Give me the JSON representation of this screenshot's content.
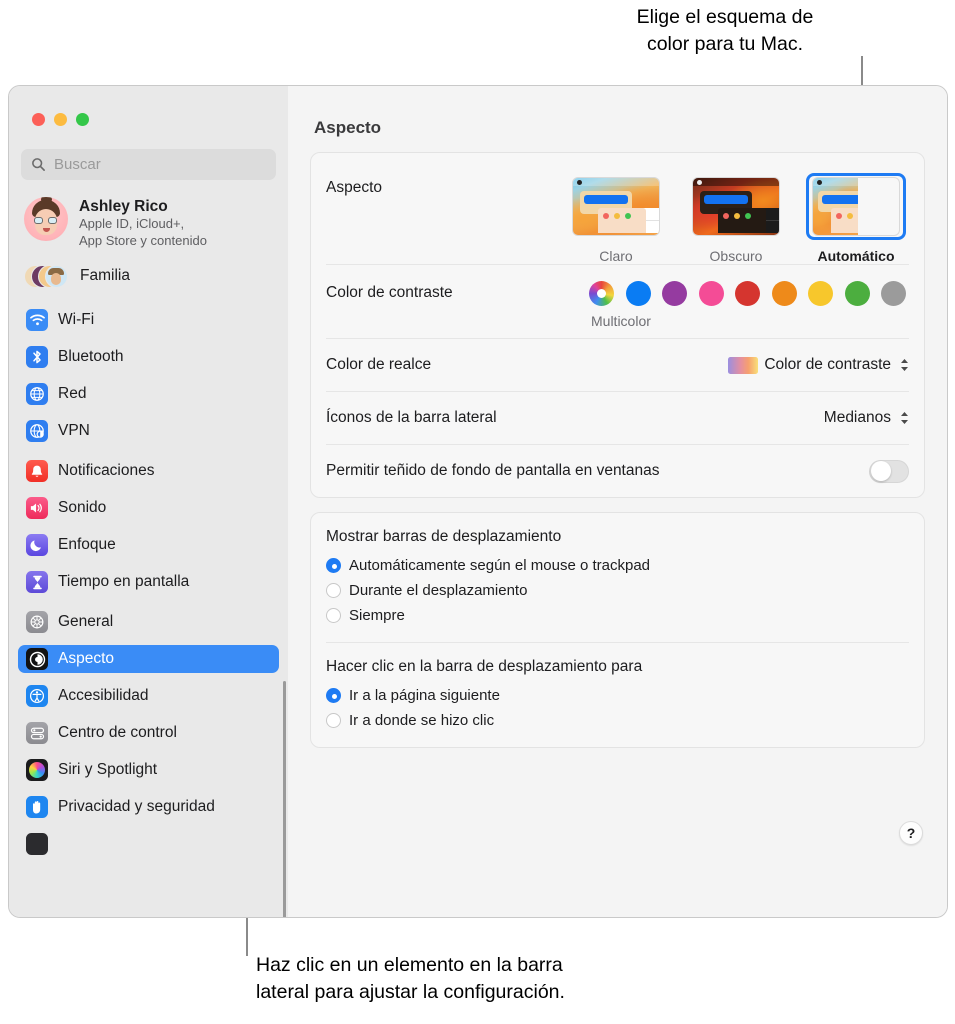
{
  "callouts": {
    "top": "Elige el esquema de\ncolor para tu Mac.",
    "bottom": "Haz clic en un elemento en la barra\nlateral para ajustar la configuración."
  },
  "window": {
    "title": "Aspecto"
  },
  "sidebar": {
    "search": {
      "placeholder": "Buscar",
      "value": ""
    },
    "account": {
      "name": "Ashley Rico",
      "subtitle_line1": "Apple ID, iCloud+,",
      "subtitle_line2": "App Store y contenido"
    },
    "family": {
      "label": "Familia"
    },
    "groups": [
      {
        "items": [
          {
            "label": "Wi-Fi",
            "icon": "wifi-icon",
            "color": "#3a8cf6",
            "selected": false
          },
          {
            "label": "Bluetooth",
            "icon": "bluetooth-icon",
            "color": "#2f7ef0",
            "selected": false
          },
          {
            "label": "Red",
            "icon": "globe-icon",
            "color": "#2f7ef0",
            "selected": false
          },
          {
            "label": "VPN",
            "icon": "vpn-globe-icon",
            "color": "#2f7ef0",
            "selected": false
          }
        ]
      },
      {
        "items": [
          {
            "label": "Notificaciones",
            "icon": "bell-icon",
            "color": "#f5453c",
            "selected": false
          },
          {
            "label": "Sonido",
            "icon": "speaker-icon",
            "color": "#f43f6e",
            "selected": false
          },
          {
            "label": "Enfoque",
            "icon": "moon-icon",
            "color": "#6d5de8",
            "selected": false
          },
          {
            "label": "Tiempo en pantalla",
            "icon": "hourglass-icon",
            "color": "#6f5fe0",
            "selected": false
          }
        ]
      },
      {
        "items": [
          {
            "label": "General",
            "icon": "gear-icon",
            "color": "#8e8e93",
            "selected": false
          },
          {
            "label": "Aspecto",
            "icon": "appearance-icon",
            "color": "#1c1c1e",
            "selected": true
          },
          {
            "label": "Accesibilidad",
            "icon": "accessibility-icon",
            "color": "#1e86f0",
            "selected": false
          },
          {
            "label": "Centro de control",
            "icon": "control-center-icon",
            "color": "#8e8e93",
            "selected": false
          },
          {
            "label": "Siri y Spotlight",
            "icon": "siri-icon",
            "color": "#2b2b2b",
            "selected": false
          },
          {
            "label": "Privacidad y seguridad",
            "icon": "hand-icon",
            "color": "#1e86f0",
            "selected": false
          }
        ]
      }
    ]
  },
  "main": {
    "appearance": {
      "label": "Aspecto",
      "options": [
        {
          "label": "Claro",
          "selected": false
        },
        {
          "label": "Obscuro",
          "selected": false
        },
        {
          "label": "Automático",
          "selected": true
        }
      ]
    },
    "accent": {
      "label": "Color de contraste",
      "caption": "Multicolor",
      "swatches": [
        {
          "name": "multicolor",
          "color": "multicolor",
          "selected": true
        },
        {
          "name": "blue",
          "color": "#0a7cf3"
        },
        {
          "name": "purple",
          "color": "#953ba0"
        },
        {
          "name": "pink",
          "color": "#f44c96"
        },
        {
          "name": "red",
          "color": "#d5352f"
        },
        {
          "name": "orange",
          "color": "#ee8a1a"
        },
        {
          "name": "yellow",
          "color": "#f7c72c"
        },
        {
          "name": "green",
          "color": "#4cae3f"
        },
        {
          "name": "graphite",
          "color": "#9b9b9b"
        }
      ]
    },
    "highlight": {
      "label": "Color de realce",
      "value": "Color de contraste"
    },
    "sidebar_icons": {
      "label": "Íconos de la barra lateral",
      "value": "Medianos"
    },
    "wallpaper_tint": {
      "label": "Permitir teñido de fondo de pantalla en ventanas",
      "enabled": false
    },
    "scrollbars": {
      "heading": "Mostrar barras de desplazamiento",
      "options": [
        {
          "label": "Automáticamente según el mouse o trackpad",
          "selected": true
        },
        {
          "label": "Durante el desplazamiento",
          "selected": false
        },
        {
          "label": "Siempre",
          "selected": false
        }
      ]
    },
    "scrollbar_click": {
      "heading": "Hacer clic en la barra de desplazamiento para",
      "options": [
        {
          "label": "Ir a la página siguiente",
          "selected": true
        },
        {
          "label": "Ir a donde se hizo clic",
          "selected": false
        }
      ]
    },
    "help_label": "?"
  }
}
